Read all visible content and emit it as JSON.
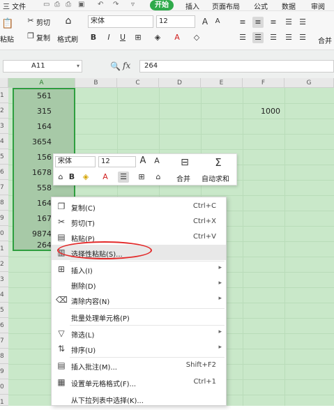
{
  "menu": {
    "file": "三 文件",
    "qa_icons": [
      "save-icon",
      "print-preview-icon",
      "print-icon",
      "preview-icon",
      "undo-icon",
      "redo-icon",
      "customize-icon"
    ],
    "tabs": [
      "开始",
      "插入",
      "页面布局",
      "公式",
      "数据",
      "审阅"
    ]
  },
  "ribbon": {
    "cut": "剪切",
    "copy": "复制",
    "paste": "粘贴",
    "format_painter": "格式刷",
    "font_name": "宋体",
    "font_size": "12",
    "merge": "合并"
  },
  "formula": {
    "namebox": "A11",
    "fx": "fx",
    "value": "264"
  },
  "grid": {
    "columns": [
      "A",
      "B",
      "C",
      "D",
      "E",
      "F",
      "G"
    ],
    "rows": [
      "1",
      "2",
      "3",
      "4",
      "5",
      "6",
      "7",
      "8",
      "9",
      "0",
      "1",
      "2",
      "3",
      "4",
      "5",
      "6",
      "7",
      "8",
      "9",
      "0",
      "1"
    ],
    "colA": [
      "561",
      "315",
      "164",
      "3654",
      "156",
      "1678",
      "558",
      "164",
      "167",
      "9874",
      "264"
    ],
    "f2": "1000"
  },
  "minitoolbar": {
    "font_name": "宋体",
    "font_size": "12",
    "merge": "合并",
    "autosum": "自动求和"
  },
  "context_menu": {
    "copy": {
      "label": "复制(C)",
      "shortcut": "Ctrl+C"
    },
    "cut": {
      "label": "剪切(T)",
      "shortcut": "Ctrl+X"
    },
    "paste": {
      "label": "粘贴(P)",
      "shortcut": "Ctrl+V"
    },
    "paste_special": {
      "label": "选择性粘贴(S)..."
    },
    "insert": {
      "label": "插入(I)"
    },
    "delete": {
      "label": "删除(D)"
    },
    "clear": {
      "label": "清除内容(N)"
    },
    "batch": {
      "label": "批量处理单元格(P)"
    },
    "filter": {
      "label": "筛选(L)"
    },
    "sort": {
      "label": "排序(U)"
    },
    "comment": {
      "label": "插入批注(M)...",
      "shortcut": "Shift+F2"
    },
    "format_cells": {
      "label": "设置单元格格式(F)...",
      "shortcut": "Ctrl+1"
    },
    "pick_list": {
      "label": "从下拉列表中选择(K)..."
    }
  },
  "colors": {
    "accent": "#2faa4a",
    "grid": "#c9e8c9",
    "highlight": "#e32a2a"
  }
}
